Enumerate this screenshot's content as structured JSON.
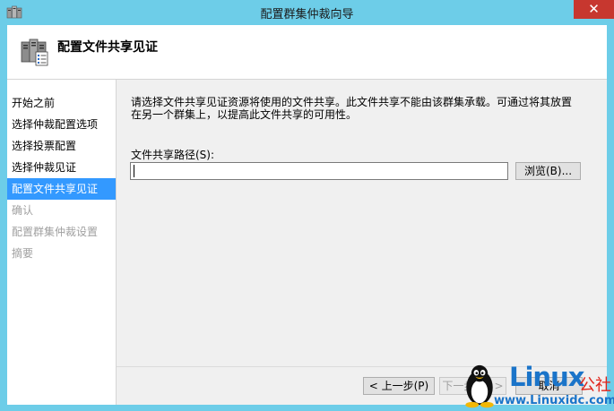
{
  "window": {
    "title": "配置群集仲裁向导",
    "close_glyph": "✕"
  },
  "header": {
    "title": "配置文件共享见证",
    "icon": "cluster-servers-icon"
  },
  "nav": {
    "items": [
      {
        "label": "开始之前",
        "state": "normal"
      },
      {
        "label": "选择仲裁配置选项",
        "state": "normal"
      },
      {
        "label": "选择投票配置",
        "state": "normal"
      },
      {
        "label": "选择仲裁见证",
        "state": "normal"
      },
      {
        "label": "配置文件共享见证",
        "state": "current"
      },
      {
        "label": "确认",
        "state": "disabled"
      },
      {
        "label": "配置群集仲裁设置",
        "state": "disabled"
      },
      {
        "label": "摘要",
        "state": "disabled"
      }
    ]
  },
  "content": {
    "description_line1": "请选择文件共享见证资源将使用的文件共享。此文件共享不能由该群集承载。可通过将其放置",
    "description_line2": "在另一个群集上，以提高此文件共享的可用性。",
    "path_label": "文件共享路径(S):",
    "path_value": "",
    "browse_label": "浏览(B)..."
  },
  "footer": {
    "back_label": "< 上一步(P)",
    "next_label": "下一步(N) >",
    "cancel_label": "取消"
  },
  "watermark": {
    "logo": "Linux",
    "cn": "公社",
    "url": "www.Linuxidc.com"
  },
  "colors": {
    "frame": "#6dcde8",
    "close": "#c7372f",
    "selection": "#3399ff",
    "brand_blue": "#1a74c9",
    "brand_red": "#e0251b"
  }
}
